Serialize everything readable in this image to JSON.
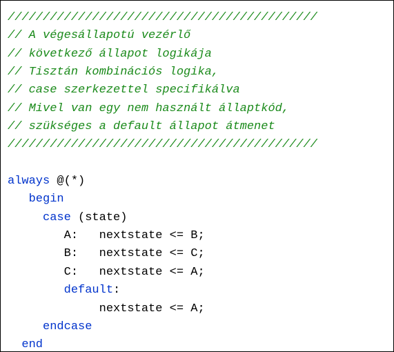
{
  "comments": {
    "bar": "////////////////////////////////////////////",
    "l1": "// A végesállapotú vezérlő",
    "l2": "// következő állapot logikája",
    "l3": "// Tisztán kombinációs logika,",
    "l4": "// case szerkezettel specifikálva",
    "l5": "// Mivel van egy nem használt állaptkód,",
    "l6": "// szükséges a default állapot átmenet"
  },
  "code": {
    "always": "always",
    "sens": " @(*)",
    "begin": "begin",
    "case": "case",
    "case_expr": " (state)",
    "rowA_lhs": "A:   nextstate <= B;",
    "rowB_lhs": "B:   nextstate <= C;",
    "rowC_lhs": "C:   nextstate <= A;",
    "default": "default",
    "colon": ":",
    "def_stmt": "nextstate <= A;",
    "endcase": "endcase",
    "end": "end"
  }
}
